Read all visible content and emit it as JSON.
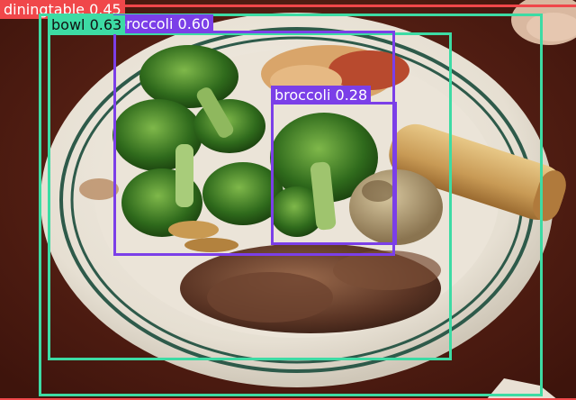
{
  "colors": {
    "diningtable": "#f0474a",
    "bowl": "#3ddba4",
    "broccoli": "#7b3fe8",
    "label_text_dark": "#111111",
    "label_text_light": "#ffffff"
  },
  "detections": [
    {
      "id": "det-diningtable",
      "label": "diningtable 0.45",
      "class": "diningtable",
      "confidence": 0.45
    },
    {
      "id": "det-bowl-outer",
      "label": "",
      "class": "bowl",
      "confidence": null
    },
    {
      "id": "det-bowl",
      "label": "bowl 0.63",
      "class": "bowl",
      "confidence": 0.63
    },
    {
      "id": "det-broccoli-large",
      "label": "broccoli 0.60",
      "class": "broccoli",
      "confidence": 0.6
    },
    {
      "id": "det-broccoli-small",
      "label": "broccoli 0.28",
      "class": "broccoli",
      "confidence": 0.28
    }
  ]
}
